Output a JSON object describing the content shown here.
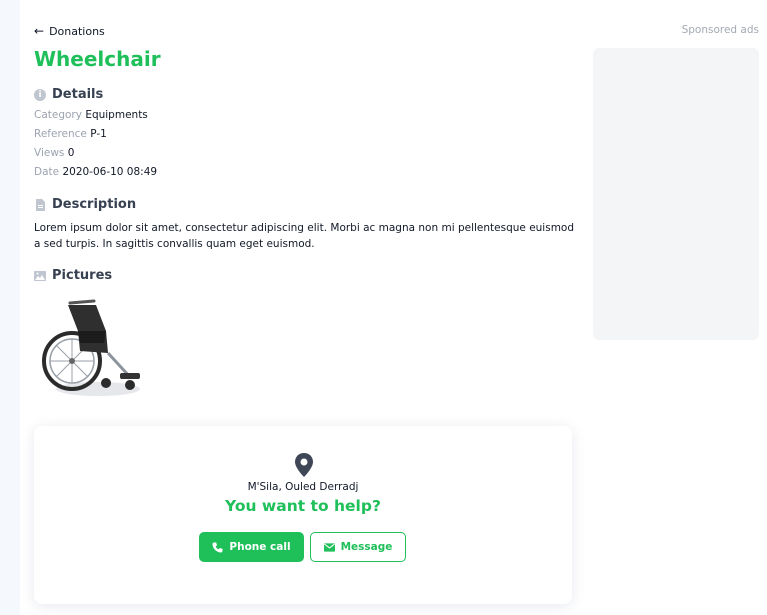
{
  "nav": {
    "back_label": "Donations"
  },
  "item": {
    "title": "Wheelchair",
    "details_heading": "Details",
    "details": [
      {
        "key": "Category",
        "value": "Equipments"
      },
      {
        "key": "Reference",
        "value": "P-1"
      },
      {
        "key": "Views",
        "value": "0"
      },
      {
        "key": "Date",
        "value": "2020-06-10 08:49"
      }
    ],
    "description_heading": "Description",
    "description": "Lorem ipsum dolor sit amet, consectetur adipiscing elit. Morbi ac magna non mi pellentesque euismod a sed turpis. In sagittis convallis quam eget euismod.",
    "pictures_heading": "Pictures"
  },
  "contact": {
    "location": "M'Sila, Ouled Derradj",
    "headline": "You want to help?",
    "phone_label": "Phone call",
    "message_label": "Message"
  },
  "sidebar": {
    "sponsored_label": "Sponsored ads"
  },
  "colors": {
    "accent": "#1fbf5a",
    "muted": "#9ca3af",
    "ad_bg": "#f4f5f7"
  },
  "icons": [
    "arrow-left-icon",
    "info-icon",
    "document-icon",
    "image-icon",
    "map-pin-icon",
    "phone-icon",
    "envelope-icon"
  ]
}
